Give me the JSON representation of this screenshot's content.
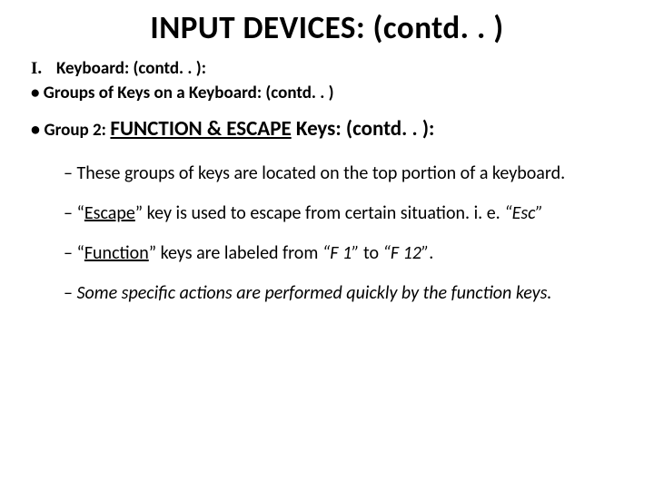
{
  "title": "INPUT DEVICES: (contd. . )",
  "heading": {
    "marker": "I.",
    "text": "Keyboard: (contd. . ):"
  },
  "bullet1": "Groups of Keys on a Keyboard: (contd. . )",
  "group2": {
    "label": "Group 2:",
    "fekeys": "FUNCTION & ESCAPE",
    "tail": " Keys: (contd. . ):"
  },
  "s1a": "These groups of keys are located on the top portion of a keyboard.",
  "s2a": "“",
  "s2b": "Escape",
  "s2c": "” key is used to escape from certain situation. i. e. ",
  "s2d": "“Esc”",
  "s3a": "“",
  "s3b": "Function",
  "s3c": "” keys are labeled from ",
  "s3d": "“F 1”",
  "s3e": " to ",
  "s3f": "“F 12”",
  "s3g": ".",
  "s4a": "Some specific actions are performed quickly by the function keys."
}
